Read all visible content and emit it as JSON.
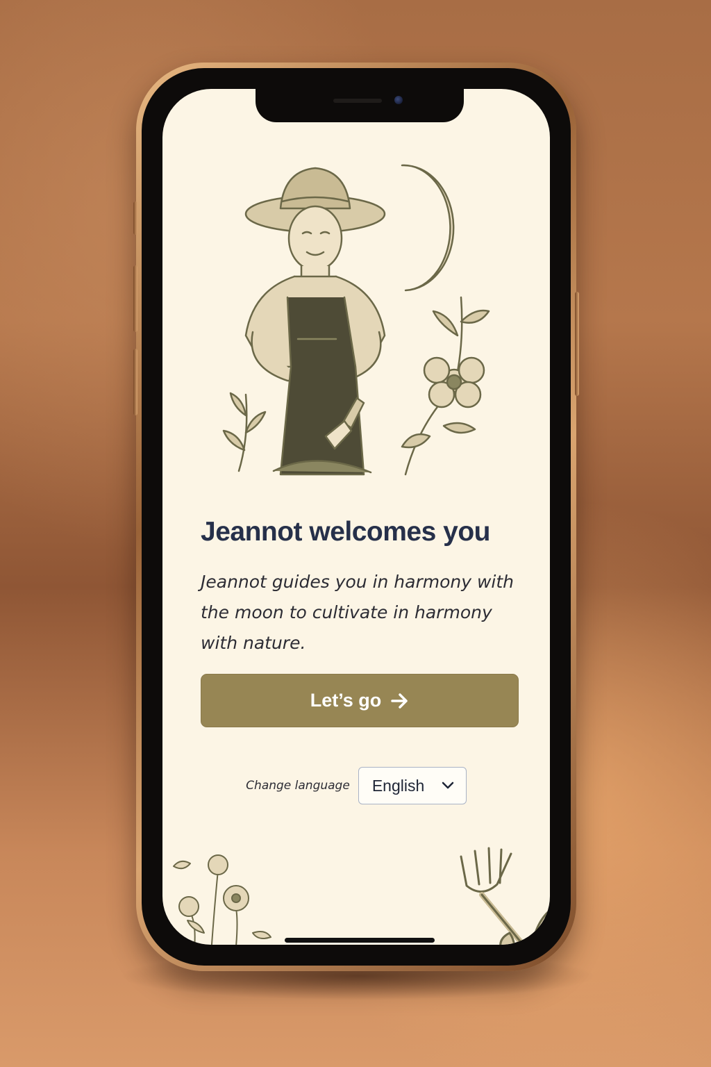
{
  "welcome": {
    "title": "Jeannot welcomes you",
    "subtitle": "Jeannot guides you in harmony with the moon to cultivate in harmony with nature.",
    "cta_label": "Let’s go",
    "cta_icon": "arrow-right-icon"
  },
  "language": {
    "label": "Change language",
    "selected": "English",
    "icon": "chevron-down-icon"
  },
  "illustration": {
    "subject": "gardener-with-moon-and-flowers"
  },
  "colors": {
    "screen_background": "#fcf5e5",
    "title": "#26304a",
    "button": "#978654",
    "button_text": "#ffffff",
    "select_border": "#a9b3c6",
    "illustration_ink": "#6b6848"
  }
}
